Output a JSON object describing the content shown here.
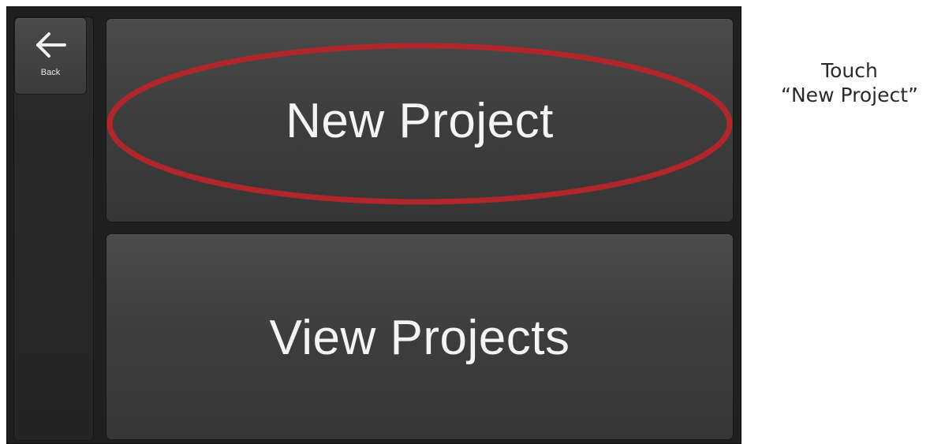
{
  "sidebar": {
    "back_label": "Back",
    "back_icon": "arrow-left-icon"
  },
  "menu": {
    "new_project_label": "New Project",
    "view_projects_label": "View Projects"
  },
  "annotation": {
    "line1": "Touch",
    "line2": "“New Project”",
    "highlight_color": "#b0262a"
  },
  "colors": {
    "screen_background": "#1f1f1f",
    "button_face": "#424242",
    "button_text": "#f4f4f4"
  }
}
